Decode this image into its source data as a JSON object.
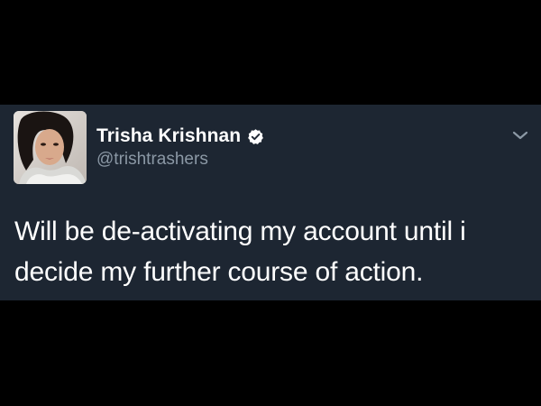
{
  "tweet": {
    "author": {
      "display_name": "Trisha Krishnan",
      "handle": "@trishtrashers",
      "verified": true,
      "avatar": "profile-photo"
    },
    "text": "Will be de-activating my account until i decide my further course of action.",
    "menu_icon": "chevron-down-icon",
    "verified_icon": "verified-badge-icon"
  },
  "colors": {
    "page_background": "#000000",
    "card_background": "#1d2632",
    "text_primary": "#ffffff",
    "text_secondary": "#8b98a5",
    "chevron": "#8b98a5"
  }
}
